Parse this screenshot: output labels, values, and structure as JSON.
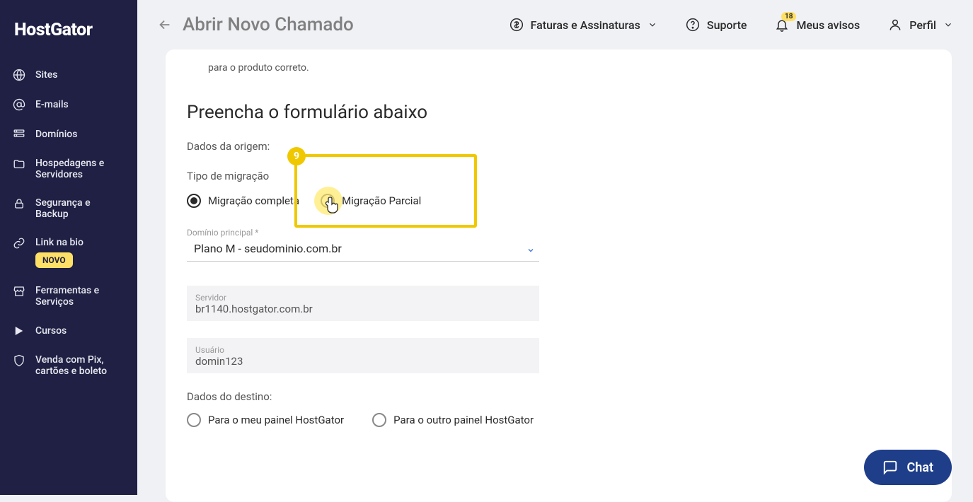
{
  "logo": "HostGator",
  "sidebar": {
    "items": [
      {
        "label": "Sites"
      },
      {
        "label": "E-mails"
      },
      {
        "label": "Domínios"
      },
      {
        "label": "Hospedagens e Servidores"
      },
      {
        "label": "Segurança e Backup"
      },
      {
        "label": "Link na bio",
        "badge": "NOVO"
      },
      {
        "label": "Ferramentas e Serviços"
      },
      {
        "label": "Cursos"
      },
      {
        "label": "Venda com Pix, cartões e boleto"
      }
    ]
  },
  "header": {
    "page_title": "Abrir Novo Chamado",
    "invoices": "Faturas e Assinaturas",
    "support": "Suporte",
    "notices": "Meus avisos",
    "notice_count": "18",
    "profile": "Perfil"
  },
  "form": {
    "note": "para o produto correto.",
    "title": "Preencha o formulário abaixo",
    "origin_label": "Dados da origem:",
    "migration_type_label": "Tipo de migração",
    "radio_full": "Migração completa",
    "radio_partial": "Migração Parcial",
    "domain_label": "Domínio principal *",
    "domain_value": "Plano M - seudominio.com.br",
    "server_label": "Servidor",
    "server_value": "br1140.hostgator.com.br",
    "user_label": "Usuário",
    "user_value": "domin123",
    "dest_label": "Dados do destino:",
    "dest_my_panel": "Para o meu painel HostGator",
    "dest_other_panel": "Para o outro painel HostGator",
    "highlight_num": "9"
  },
  "chat_label": "Chat"
}
